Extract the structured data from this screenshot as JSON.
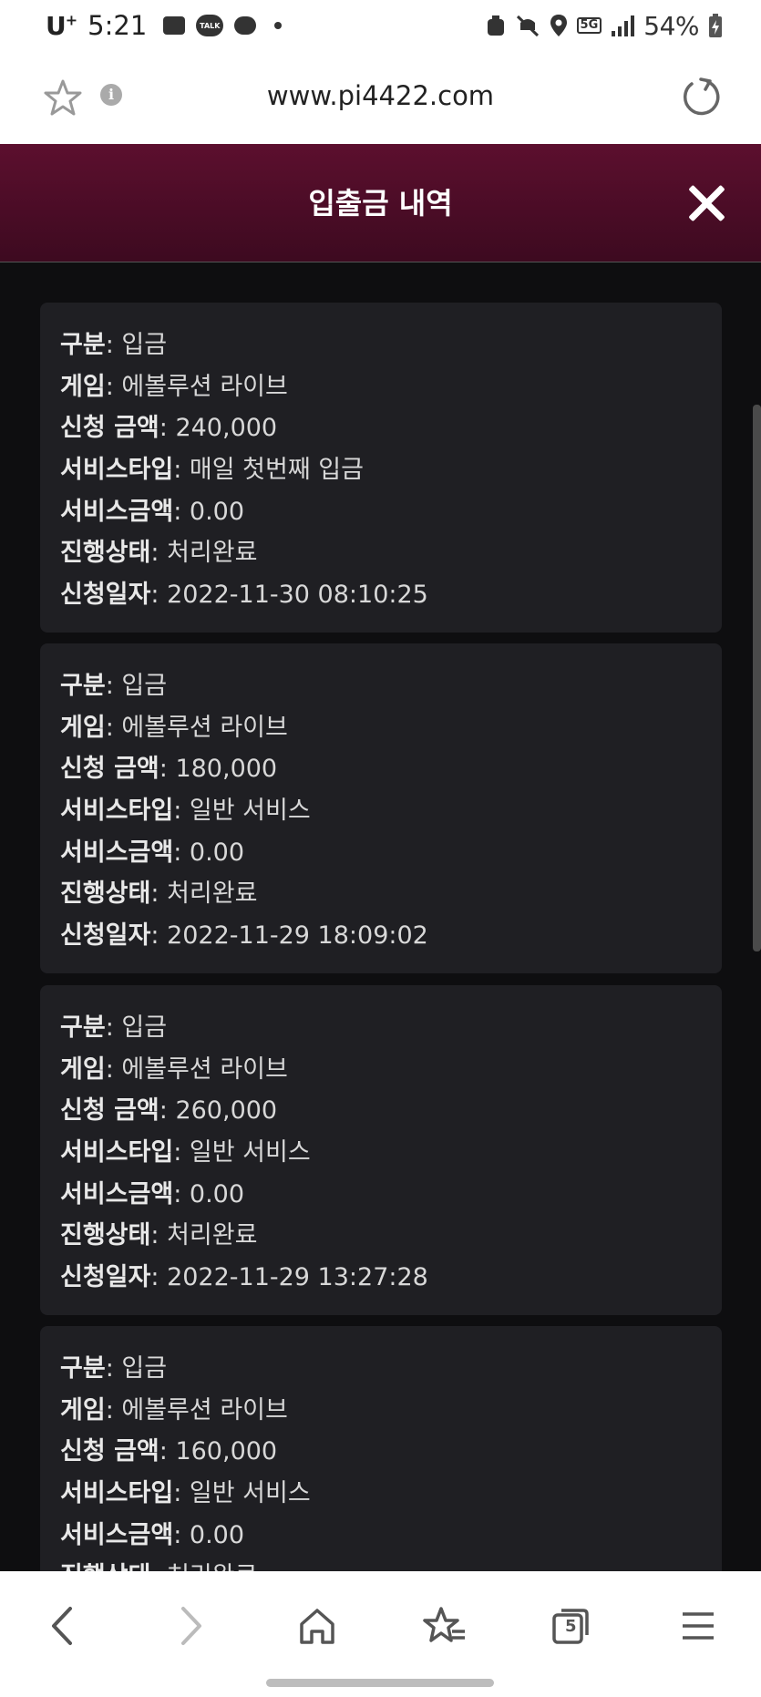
{
  "status_bar": {
    "carrier": "U",
    "carrier_sup": "+",
    "time": "5:21",
    "talk_label": "TALK",
    "network": "5G",
    "battery": "54%"
  },
  "browser": {
    "url": "www.pi4422.com",
    "info_glyph": "i",
    "icons": [
      "star-icon",
      "info-icon",
      "reload-icon"
    ]
  },
  "modal": {
    "title": "입출금 내역",
    "close_icon": "close-icon"
  },
  "labels": {
    "type": "구분",
    "game": "게임",
    "amount": "신청 금액",
    "service_type": "서비스타입",
    "service_amount": "서비스금액",
    "status": "진행상태",
    "date": "신청일자"
  },
  "transactions": [
    {
      "type": "입금",
      "game": "에볼루션 라이브",
      "amount": "240,000",
      "service_type": "매일 첫번째 입금",
      "service_amount": "0.00",
      "status": "처리완료",
      "date": "2022-11-30 08:10:25"
    },
    {
      "type": "입금",
      "game": "에볼루션 라이브",
      "amount": "180,000",
      "service_type": "일반 서비스",
      "service_amount": "0.00",
      "status": "처리완료",
      "date": "2022-11-29 18:09:02"
    },
    {
      "type": "입금",
      "game": "에볼루션 라이브",
      "amount": "260,000",
      "service_type": "일반 서비스",
      "service_amount": "0.00",
      "status": "처리완료",
      "date": "2022-11-29 13:27:28"
    },
    {
      "type": "입금",
      "game": "에볼루션 라이브",
      "amount": "160,000",
      "service_type": "일반 서비스",
      "service_amount": "0.00",
      "status": "처리완료",
      "date": ""
    }
  ],
  "bottom_nav": {
    "tab_count": "5",
    "icons": [
      "back-icon",
      "forward-icon",
      "home-icon",
      "bookmarks-icon",
      "tabs-icon",
      "menu-icon"
    ]
  }
}
